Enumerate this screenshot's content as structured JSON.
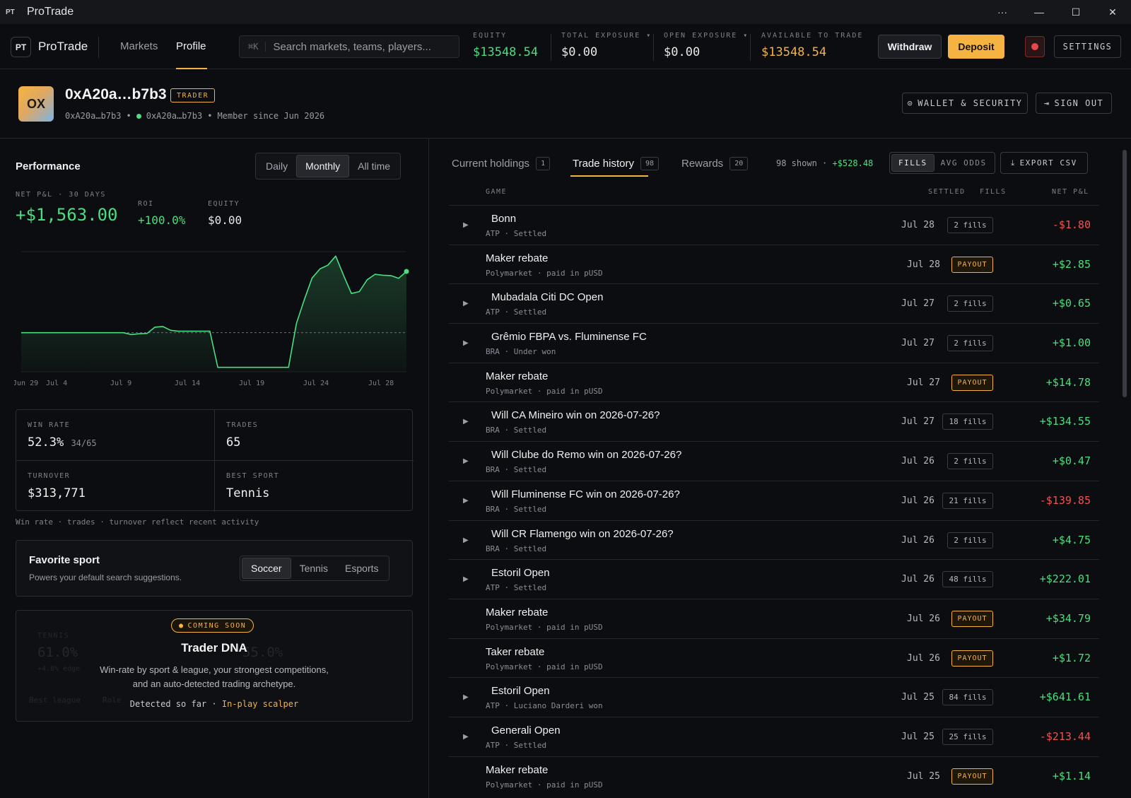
{
  "window": {
    "logo": "PT",
    "title": "ProTrade",
    "more": "···",
    "minimize": "—",
    "maximize": "☐",
    "close": "✕"
  },
  "nav": {
    "brand_mark": "PT",
    "brand": "ProTrade",
    "items": [
      "Markets",
      "Profile"
    ],
    "active": "Profile",
    "search_kbd": "⌘K",
    "search_placeholder": "Search markets, teams, players...",
    "metrics": [
      {
        "label": "EQUITY",
        "value": "$13548.54",
        "color": "#4ade80"
      },
      {
        "label": "TOTAL EXPOSURE ▾",
        "value": "$0.00",
        "color": "#e8e8ea"
      },
      {
        "label": "OPEN EXPOSURE ▾",
        "value": "$0.00",
        "color": "#e8e8ea"
      },
      {
        "label": "AVAILABLE TO TRADE",
        "value": "$13548.54",
        "color": "#f5b342"
      }
    ],
    "withdraw": "Withdraw",
    "deposit": "Deposit",
    "settings": "SETTINGS"
  },
  "profile": {
    "avatar": "OX",
    "name": "0xA20a…b7b3",
    "badge": "TRADER",
    "address": "0xA20a…b7b3",
    "wallet": "0xA20a…b7b3",
    "member_since": "Member since Jun 2026",
    "wallet_security": "WALLET & SECURITY",
    "sign_out": "SIGN OUT"
  },
  "performance": {
    "title": "Performance",
    "ranges": [
      "Daily",
      "Monthly",
      "All time"
    ],
    "active_range": "Monthly",
    "net_pnl_label": "NET P&L · 30 DAYS",
    "net_pnl": "+$1,563.00",
    "roi_label": "ROI",
    "roi": "+100.0%",
    "equity_label": "EQUITY",
    "equity": "$0.00",
    "note": "Win rate · trades · turnover reflect recent activity"
  },
  "chart_data": {
    "type": "area",
    "x_ticks": [
      "Jun 29",
      "Jul 4",
      "Jul 9",
      "Jul 14",
      "Jul 19",
      "Jul 24",
      "Jul 28"
    ],
    "baseline": 0,
    "series": [
      {
        "values": [
          0,
          0,
          0,
          0,
          0,
          0,
          0,
          0,
          0,
          0,
          0,
          0,
          0,
          0,
          -10,
          -6,
          -4,
          30,
          34,
          13,
          8,
          8,
          8,
          8,
          8,
          -190,
          -190,
          -190,
          -190,
          -190,
          -190,
          -190,
          -190,
          -190,
          -190,
          50,
          180,
          300,
          350,
          370,
          420,
          315,
          215,
          225,
          290,
          320,
          315,
          313,
          298,
          336
        ]
      }
    ]
  },
  "stats": {
    "win_rate_label": "WIN RATE",
    "win_rate": "52.3%",
    "win_rate_detail": "34/65",
    "trades_label": "TRADES",
    "trades": "65",
    "turnover_label": "TURNOVER",
    "turnover": "$313,771",
    "best_sport_label": "BEST SPORT",
    "best_sport": "Tennis"
  },
  "favorite": {
    "title": "Favorite sport",
    "subtitle": "Powers your default search suggestions.",
    "options": [
      "Soccer",
      "Tennis",
      "Esports"
    ],
    "active": "Soccer"
  },
  "dna": {
    "badge": "COMING SOON",
    "title": "Trader DNA",
    "desc_line1": "Win-rate by sport & league, your strongest competitions,",
    "desc_line2": "and an auto-detected trading archetype.",
    "detected_prefix": "Detected so far ·",
    "detected": "In-play scalper",
    "ghost_label": "TENNIS",
    "ghost_value1": "61.0%",
    "ghost_edge": "+4.8% edge",
    "ghost_value2": "55.0%",
    "ghost_footer1": "Best league",
    "ghost_footer2": "Role"
  },
  "history": {
    "tabs": [
      {
        "label": "Current holdings",
        "count": "1"
      },
      {
        "label": "Trade history",
        "count": "98"
      },
      {
        "label": "Rewards",
        "count": "20"
      }
    ],
    "shown": "98 shown",
    "shown_total": "+$528.48",
    "toggle": [
      "FILLS",
      "AVG ODDS"
    ],
    "toggle_active": "FILLS",
    "export": "EXPORT CSV",
    "columns": {
      "game": "GAME",
      "settled": "SETTLED",
      "fills": "FILLS",
      "pnl": "NET P&L"
    },
    "rows": [
      {
        "title": "Bonn",
        "sub": "ATP · Settled",
        "date": "Jul 28",
        "fills": "2 fills",
        "pnl": "-$1.80",
        "neg": true,
        "expand": true
      },
      {
        "title": "Maker rebate",
        "sub": "Polymarket · paid in pUSD",
        "date": "Jul 28",
        "payout": "PAYOUT",
        "pnl": "+$2.85",
        "neg": false,
        "expand": false
      },
      {
        "title": "Mubadala Citi DC Open",
        "sub": "ATP · Settled",
        "date": "Jul 27",
        "fills": "2 fills",
        "pnl": "+$0.65",
        "neg": false,
        "expand": true
      },
      {
        "title": "Grêmio FBPA vs. Fluminense FC",
        "sub": "BRA · Under won",
        "date": "Jul 27",
        "fills": "2 fills",
        "pnl": "+$1.00",
        "neg": false,
        "expand": true
      },
      {
        "title": "Maker rebate",
        "sub": "Polymarket · paid in pUSD",
        "date": "Jul 27",
        "payout": "PAYOUT",
        "pnl": "+$14.78",
        "neg": false,
        "expand": false
      },
      {
        "title": "Will CA Mineiro win on 2026-07-26?",
        "sub": "BRA · Settled",
        "date": "Jul 27",
        "fills": "18 fills",
        "pnl": "+$134.55",
        "neg": false,
        "expand": true
      },
      {
        "title": "Will Clube do Remo win on 2026-07-26?",
        "sub": "BRA · Settled",
        "date": "Jul 26",
        "fills": "2 fills",
        "pnl": "+$0.47",
        "neg": false,
        "expand": true
      },
      {
        "title": "Will Fluminense FC win on 2026-07-26?",
        "sub": "BRA · Settled",
        "date": "Jul 26",
        "fills": "21 fills",
        "pnl": "-$139.85",
        "neg": true,
        "expand": true
      },
      {
        "title": "Will CR Flamengo win on 2026-07-26?",
        "sub": "BRA · Settled",
        "date": "Jul 26",
        "fills": "2 fills",
        "pnl": "+$4.75",
        "neg": false,
        "expand": true
      },
      {
        "title": "Estoril Open",
        "sub": "ATP · Settled",
        "date": "Jul 26",
        "fills": "48 fills",
        "pnl": "+$222.01",
        "neg": false,
        "expand": true
      },
      {
        "title": "Maker rebate",
        "sub": "Polymarket · paid in pUSD",
        "date": "Jul 26",
        "payout": "PAYOUT",
        "pnl": "+$34.79",
        "neg": false,
        "expand": false
      },
      {
        "title": "Taker rebate",
        "sub": "Polymarket · paid in pUSD",
        "date": "Jul 26",
        "payout": "PAYOUT",
        "pnl": "+$1.72",
        "neg": false,
        "expand": false
      },
      {
        "title": "Estoril Open",
        "sub": "ATP · Luciano Darderi won",
        "date": "Jul 25",
        "fills": "84 fills",
        "pnl": "+$641.61",
        "neg": false,
        "expand": true
      },
      {
        "title": "Generali Open",
        "sub": "ATP · Settled",
        "date": "Jul 25",
        "fills": "25 fills",
        "pnl": "-$213.44",
        "neg": true,
        "expand": true
      },
      {
        "title": "Maker rebate",
        "sub": "Polymarket · paid in pUSD",
        "date": "Jul 25",
        "payout": "PAYOUT",
        "pnl": "+$1.14",
        "neg": false,
        "expand": false
      }
    ]
  }
}
